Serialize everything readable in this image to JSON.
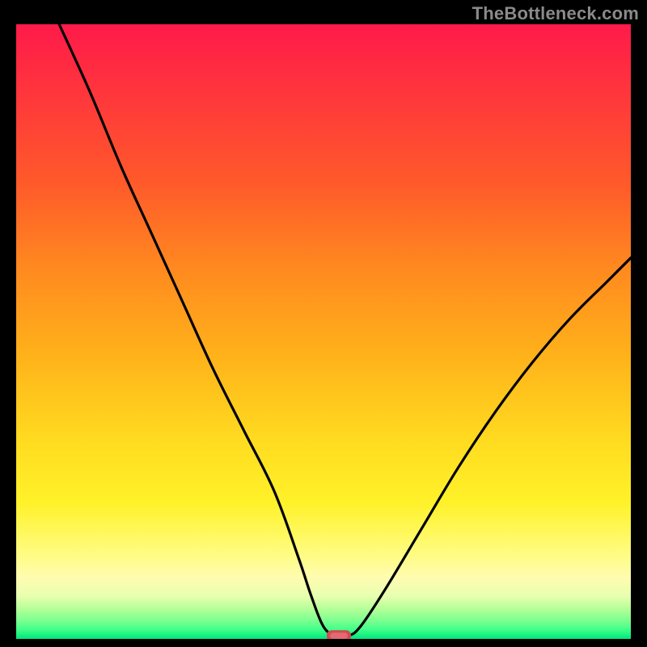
{
  "watermark": "TheBottleneck.com",
  "chart_data": {
    "type": "line",
    "title": "",
    "xlabel": "",
    "ylabel": "",
    "xlim": [
      0,
      100
    ],
    "ylim": [
      0,
      100
    ],
    "grid": false,
    "gradient_bands": [
      {
        "y0": 100,
        "y1": 74,
        "color_top": "#ff1a4a",
        "color_bottom": "#ff5a2a"
      },
      {
        "y0": 74,
        "y1": 46,
        "color_top": "#ff5a2a",
        "color_bottom": "#ffb21a"
      },
      {
        "y0": 46,
        "y1": 22,
        "color_top": "#ffb21a",
        "color_bottom": "#fff22a"
      },
      {
        "y0": 22,
        "y1": 10,
        "color_top": "#fff22a",
        "color_bottom": "#fffc9a"
      },
      {
        "y0": 10,
        "y1": 4,
        "color_top": "#fffc9a",
        "color_bottom": "#c8ff90"
      },
      {
        "y0": 4,
        "y1": 2,
        "color_top": "#c8ff90",
        "color_bottom": "#5fff8c"
      },
      {
        "y0": 2,
        "y1": 0,
        "color_top": "#5fff8c",
        "color_bottom": "#00e77e"
      }
    ],
    "series": [
      {
        "name": "bottleneck-curve",
        "x": [
          7,
          12,
          17,
          22,
          27,
          32,
          37,
          42,
          46,
          48,
          50,
          52,
          54,
          56,
          60,
          66,
          72,
          78,
          84,
          90,
          96,
          100
        ],
        "y": [
          100,
          89,
          77,
          66,
          55,
          44,
          34,
          24,
          13,
          7,
          2,
          0.5,
          0.5,
          2,
          8,
          18,
          28,
          37,
          45,
          52,
          58,
          62
        ]
      }
    ],
    "flat_bottom": {
      "x0": 50,
      "x1": 54,
      "y": 0.5
    },
    "marker": {
      "x": 52.5,
      "y": 0.5,
      "color": "#d44a52"
    }
  }
}
